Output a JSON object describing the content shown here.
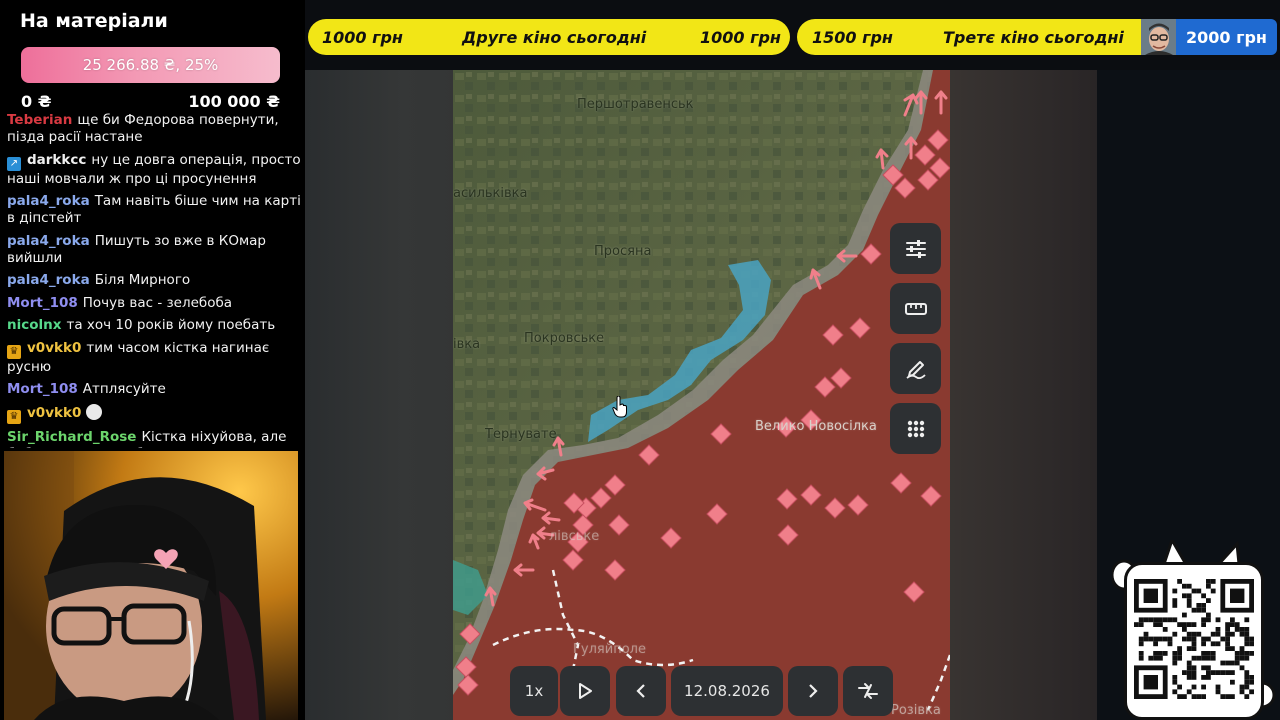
{
  "goal": {
    "title": "На матеріали",
    "progress_text": "25 266.88 ₴, 25%",
    "progress_fraction": 0.25,
    "min_label": "0 ₴",
    "max_label": "100 000 ₴"
  },
  "chat": {
    "cut_top": "",
    "messages": [
      {
        "user": "Teberian",
        "color": "#d93a42",
        "badge": "",
        "text": "ще би Федорова повернути, пізда расії настане"
      },
      {
        "user": "darkkcc",
        "color": "#f0f0f0",
        "badge": "verified",
        "text": "ну це довга операція, просто наші мовчали ж про ці просунення"
      },
      {
        "user": "pala4_roka",
        "color": "#8aa9ec",
        "badge": "",
        "text": "Там навіть біше чим на карті в діпстейт"
      },
      {
        "user": "pala4_roka",
        "color": "#8aa9ec",
        "badge": "",
        "text": "Пишуть зо вже в КОмар вийшли"
      },
      {
        "user": "pala4_roka",
        "color": "#8aa9ec",
        "badge": "",
        "text": "Біля Мирного"
      },
      {
        "user": "Mort_108",
        "color": "#8f8ef0",
        "badge": "",
        "text": "Почув вас - зелебоба"
      },
      {
        "user": "nicolnx",
        "color": "#57d98b",
        "badge": "",
        "text": "та хоч 10 років йому поебать"
      },
      {
        "user": "v0vkk0",
        "color": "#f0c341",
        "badge": "crown",
        "text": "тим часом кістка нагинає русню"
      },
      {
        "user": "Mort_108",
        "color": "#8f8ef0",
        "badge": "",
        "text": "Атплясуйте"
      },
      {
        "user": "v0vkk0",
        "color": "#f0c341",
        "badge": "crown",
        "text": "",
        "emote": "ghost-emote"
      },
      {
        "user": "Sir_Richard_Rose",
        "color": "#6cd46c",
        "badge": "",
        "text": "Кістка ніхуйова, але бабло і далі мити буде носате кодло"
      }
    ]
  },
  "banners": {
    "first": {
      "left_amount": "1000 грн",
      "title": "Друге кіно сьогодні",
      "right_amount": "1000 грн"
    },
    "second": {
      "left_amount": "1500 грн",
      "title": "Третє кіно сьогодні"
    },
    "donor_amount": "2000 грн"
  },
  "map": {
    "labels": {
      "pershotravensk": "Першотравенськ",
      "vasylkivka": "асильківка",
      "prosiana": "Просяна",
      "pokrovske": "Покровське",
      "ivka": "івка",
      "ternuvate": "Тернувате",
      "novosilka": "Велико Новосілка",
      "bottom_left": "лівське",
      "bottom": "Гуляйполе",
      "bottom_right": "Розівка"
    }
  },
  "toolbar": {
    "icons": [
      "sliders-icon",
      "ruler-icon",
      "draw-icon",
      "grid-icon"
    ]
  },
  "timeline": {
    "speed": "1x",
    "date": "12.08.2026"
  },
  "colors": {
    "banner_yellow": "#f2e616",
    "donor_blue": "#1f6ad1",
    "occupied": "#8a3a30",
    "liberated": "#4aa3c2",
    "marker": "#f07f8a"
  }
}
